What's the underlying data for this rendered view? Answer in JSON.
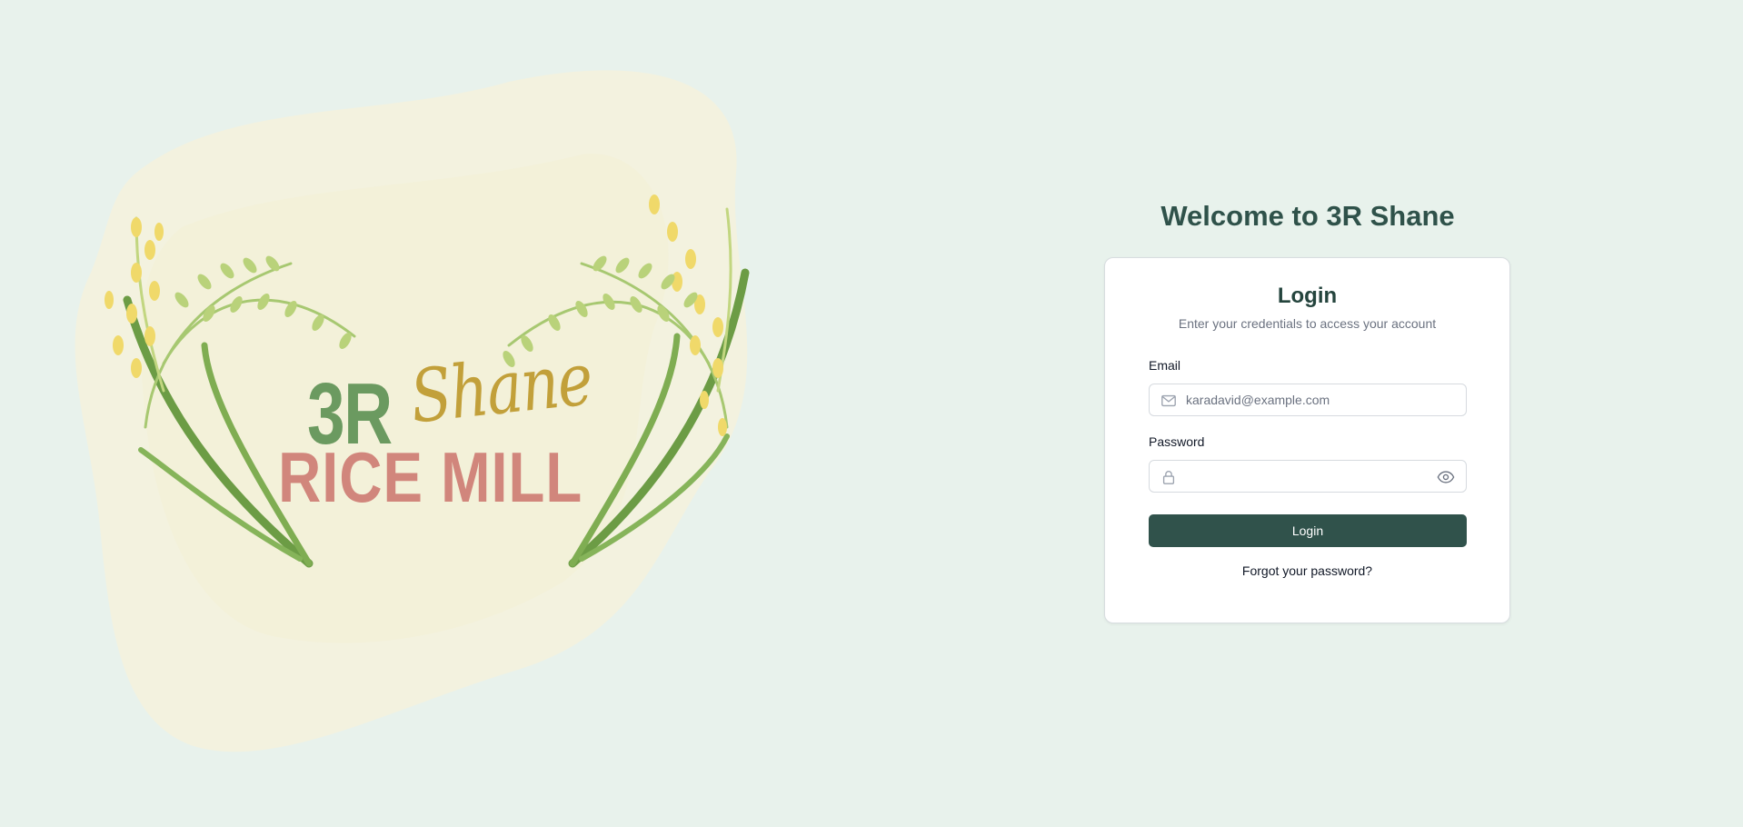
{
  "brand": {
    "logo_line1_a": "3R",
    "logo_line1_b": "Shane",
    "logo_line2": "RICE MILL"
  },
  "welcome_title": "Welcome to 3R Shane",
  "login_card": {
    "title": "Login",
    "subtitle": "Enter your credentials to access your account",
    "email_label": "Email",
    "email_placeholder": "karadavid@example.com",
    "email_icon": "mail-icon",
    "password_label": "Password",
    "password_value": "",
    "password_icon": "lock-icon",
    "visibility_icon": "eye-icon",
    "submit_label": "Login",
    "forgot_label": "Forgot your password?"
  },
  "colors": {
    "background": "#e8f2ec",
    "primary": "#30524b",
    "heading": "#2f524a",
    "logo_green": "#6b9a60",
    "logo_gold": "#c2a03a",
    "logo_red": "#d1867c"
  }
}
